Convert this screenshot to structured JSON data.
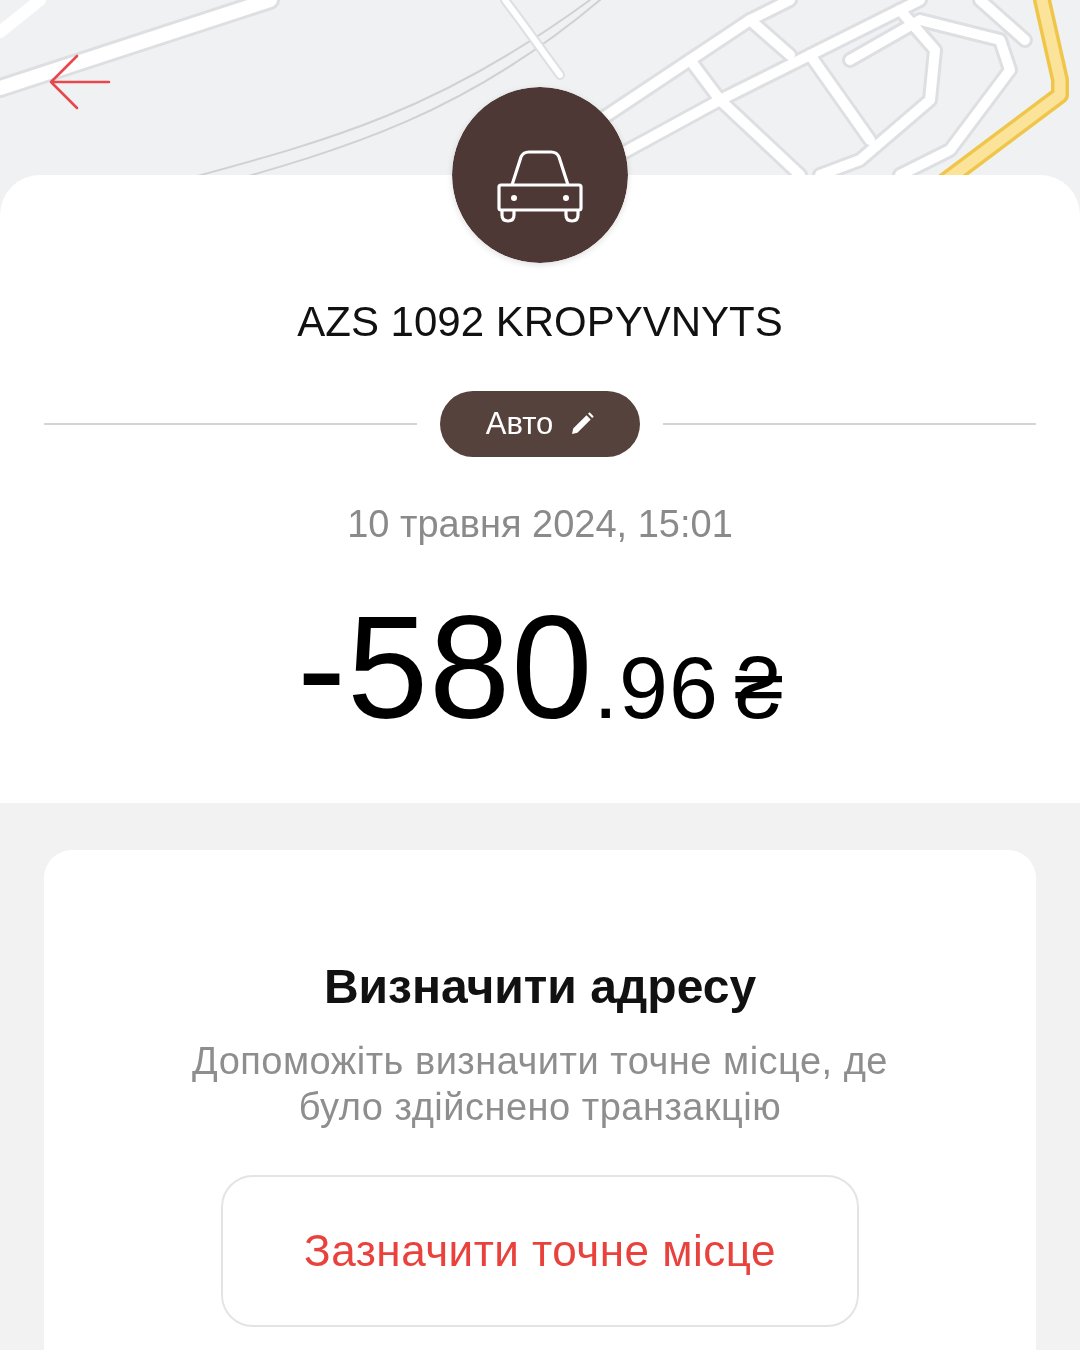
{
  "transaction": {
    "merchant": "AZS 1092 KROPYVNYTS",
    "category": "Авто",
    "date": "10 травня 2024, 15:01",
    "amount": {
      "whole": "-580",
      "fraction": ".96",
      "currency": "₴"
    }
  },
  "address_card": {
    "title": "Визначити адресу",
    "description": "Допоможіть визначити точне місце, де було здійснено транзакцію",
    "button": "Зазначити точне місце"
  }
}
